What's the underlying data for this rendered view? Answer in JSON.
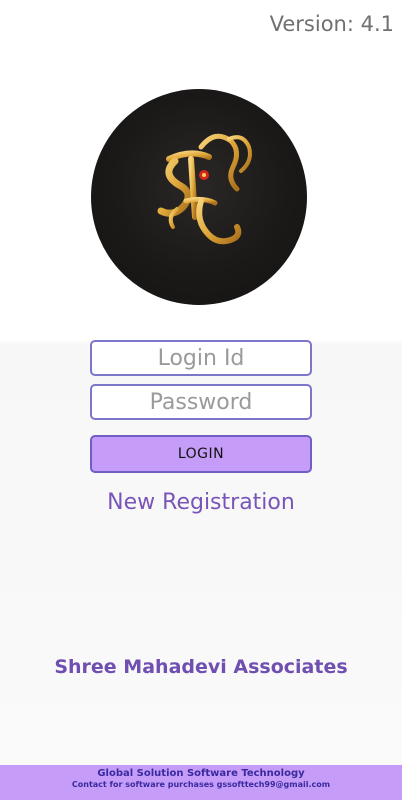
{
  "version_label": "Version: 4.1",
  "login_form": {
    "login_id_placeholder": "Login Id",
    "password_placeholder": "Password",
    "login_button_label": "LOGIN",
    "new_registration_label": "New Registration"
  },
  "company_name": "Shree Mahadevi Associates",
  "footer": {
    "line1": "Global Solution Software Technology",
    "line2": "Contact for software purchases gssofttech99@gmail.com"
  },
  "colors": {
    "accent": "#c59cf7",
    "field_border": "#7b76c8",
    "link_text": "#7a55b8",
    "footer_text": "#3a2aa0",
    "logo_bg": "#1b1918",
    "logo_gold": "#e0a83a"
  },
  "icons": {
    "logo": "shree-ganesh-logo"
  }
}
